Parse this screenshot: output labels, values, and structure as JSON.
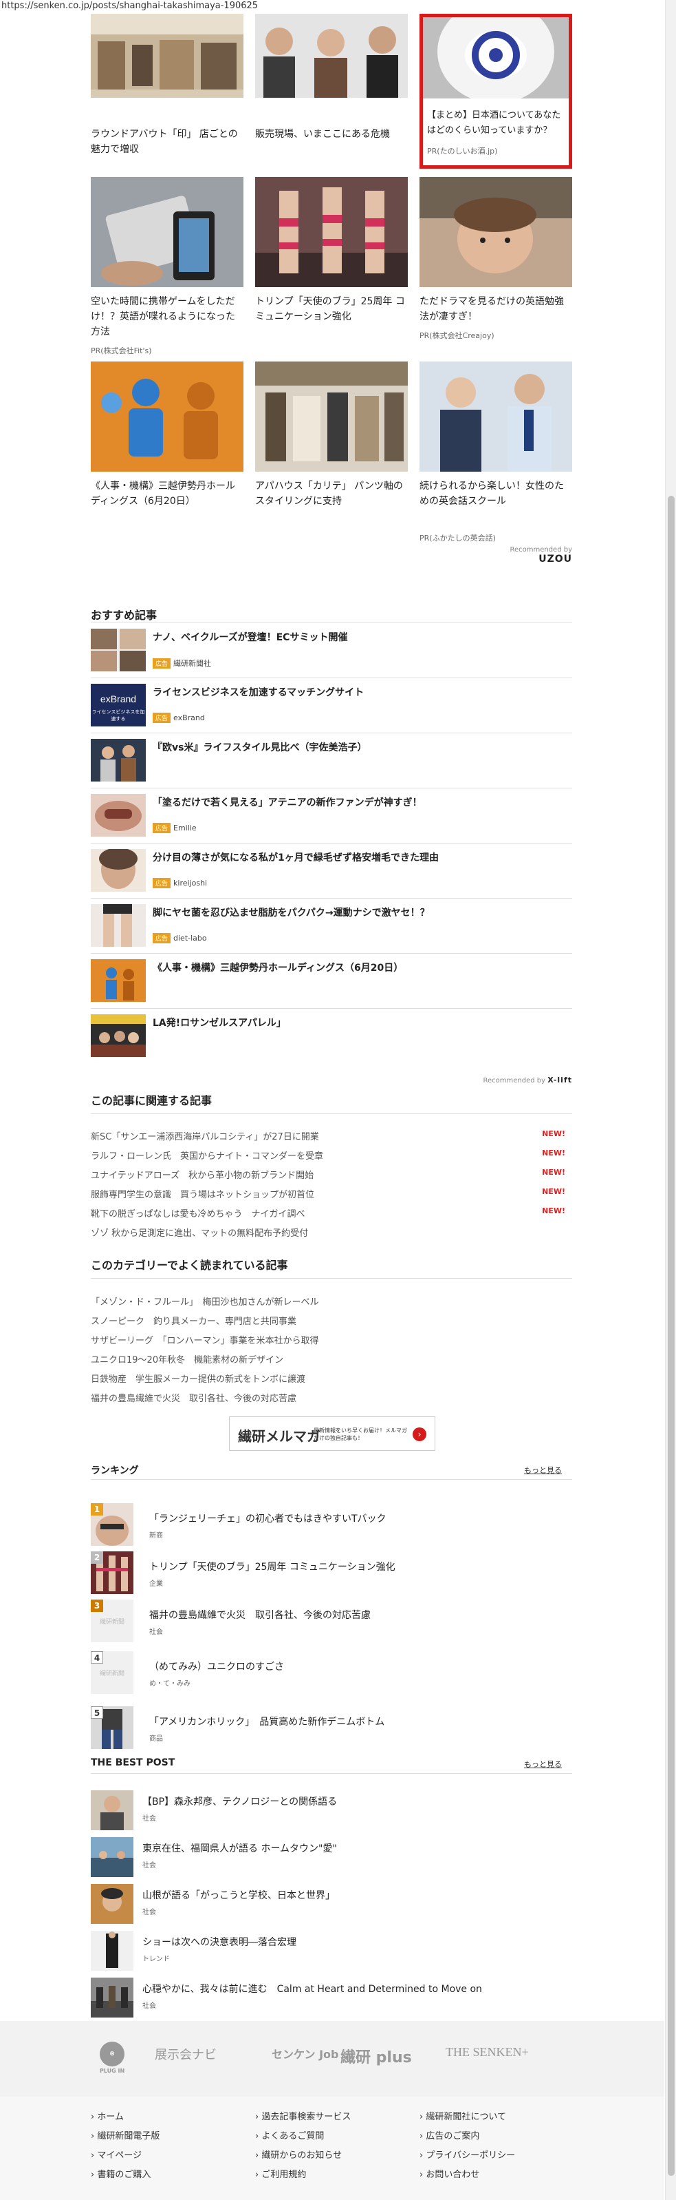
{
  "url": "https://senken.co.jp/posts/shanghai-takashimaya-190625",
  "ads": [
    {
      "title": "ラウンドアバウト「印」 店ごとの魅力で増収",
      "pr": ""
    },
    {
      "title": "販売現場、いまここにある危機",
      "pr": ""
    },
    {
      "title": "【まとめ】日本酒についてあなたはどのくらい知っていますか？",
      "pr": "PR(たのしいお酒.jp)"
    },
    {
      "title": "空いた時間に携帯ゲームをしただけ！？英語が喋れるようになった方法",
      "pr": "PR(株式会社Fit's)"
    },
    {
      "title": "トリンプ「天使のブラ」25周年 コミュニケーション強化",
      "pr": ""
    },
    {
      "title": "ただドラマを見るだけの英語勉強法が凄すぎ！",
      "pr": "PR(株式会社Creajoy)"
    },
    {
      "title": "《人事・機構》三越伊勢丹ホールディングス（6月20日）",
      "pr": ""
    },
    {
      "title": "アパハウス「カリテ」 パンツ軸のスタイリングに支持",
      "pr": ""
    },
    {
      "title": "続けられるから楽しい！女性のための英会話スクール",
      "pr": "PR(ふかたしの英会話)"
    }
  ],
  "recommended_by_1": {
    "label": "Recommended by",
    "brand": "UZOU"
  },
  "osusume": {
    "heading": "おすすめ記事",
    "items": [
      {
        "title": "ナノ、ベイクルーズが登壇！ECサミット開催",
        "tag": "広告",
        "source": "繊研新聞社"
      },
      {
        "title": "ライセンスビジネスを加速するマッチングサイト",
        "tag": "広告",
        "source": "exBrand"
      },
      {
        "title": "『欧vs米』ライフスタイル見比べ（宇佐美浩子）",
        "tag": "",
        "source": ""
      },
      {
        "title": "「塗るだけで若く見える」アテニアの新作ファンデが神すぎ！",
        "tag": "広告",
        "source": "Emilie"
      },
      {
        "title": "分け目の薄さが気になる私が1ヶ月で緑毛ぜず格安増毛できた理由",
        "tag": "広告",
        "source": "kireijoshi"
      },
      {
        "title": "脚にヤセ菌を忍び込ませ脂肪をパクパク→運動ナシで激ヤセ！？",
        "tag": "広告",
        "source": "diet-labo"
      },
      {
        "title": "《人事・機構》三越伊勢丹ホールディングス（6月20日）",
        "tag": "",
        "source": ""
      },
      {
        "title": "LA発!ロサンゼルスアパレル」",
        "tag": "",
        "source": ""
      }
    ],
    "recby": "Recommended by",
    "recby_brand": "X-lift",
    "exbrand_logo": "exBrand",
    "exbrand_sub": "ライセンスビジネスを加速する"
  },
  "related": {
    "heading": "この記事に関連する記事",
    "new_label": "NEW!",
    "items": [
      {
        "title": "新SC「サンエー浦添西海岸パルコシティ」が27日に開業",
        "new": true
      },
      {
        "title": "ラルフ・ローレン氏　英国からナイト・コマンダーを受章",
        "new": true
      },
      {
        "title": "ユナイテッドアローズ　秋から革小物の新ブランド開始",
        "new": true
      },
      {
        "title": "服飾専門学生の意識　買う場はネットショップが初首位",
        "new": true
      },
      {
        "title": "靴下の脱ぎっぱなしは愛も冷めちゃう　ナイガイ調べ",
        "new": true
      },
      {
        "title": "ゾゾ 秋から足測定に進出、マットの無料配布予約受付",
        "new": false
      }
    ]
  },
  "category": {
    "heading": "このカテゴリーでよく読まれている記事",
    "items": [
      "「メゾン・ド・フルール」　梅田沙也加さんが新レーベル",
      "スノーピーク　釣り具メーカー、専門店と共同事業",
      "サザビーリーグ　「ロンハーマン」事業を米本社から取得",
      "ユニクロ19～20年秋冬　機能素材の新デザイン",
      "日鉄物産　学生服メーカー提供の新式をトンボに譲渡",
      "福井の豊島繊維で火災　取引各社、今後の対応苦慮"
    ]
  },
  "mailmag": {
    "title": "繊研メルマガ",
    "sub": "最新情報をいち早くお届け！メルマガだけの独自記事も！",
    "btn": "›"
  },
  "ranking": {
    "heading": "ランキング",
    "more": "もっと見る",
    "items": [
      {
        "rank": "1",
        "title": "「ランジェリーチェ」の初心者でもはきやすいTバック",
        "cat": "新商"
      },
      {
        "rank": "2",
        "title": "トリンプ「天使のブラ」25周年 コミュニケーション強化",
        "cat": "企業"
      },
      {
        "rank": "3",
        "title": "福井の豊島繊維で火災　取引各社、今後の対応苦慮",
        "cat": "社会"
      },
      {
        "rank": "4",
        "title": "（めてみみ）ユニクロのすごさ",
        "cat": "め・て・みみ"
      },
      {
        "rank": "5",
        "title": "「アメリカンホリック」　品質高めた新作デニムボトム",
        "cat": "商品"
      }
    ],
    "placeholder": "繊研新聞"
  },
  "best": {
    "heading": "THE BEST POST",
    "more": "もっと見る",
    "items": [
      {
        "title": "【BP】森永邦彦、テクノロジーとの関係語る",
        "cat": "社会"
      },
      {
        "title": "東京在住、福岡県人が語る ホームタウン\"愛\"",
        "cat": "社会"
      },
      {
        "title": "山根が語る「がっこうと学校、日本と世界」",
        "cat": "社会"
      },
      {
        "title": "ショーは次への決意表明―落合宏理",
        "cat": "トレンド"
      },
      {
        "title": "心穏やかに、我々は前に進む　Calm at Heart and Determined to Move on",
        "cat": "社会"
      }
    ]
  },
  "footer_brands": [
    "PLUG IN",
    "展示会ナビ",
    "センケン Job",
    "繊研 plus",
    "THE SENKEN+"
  ],
  "footer_links": [
    [
      "ホーム",
      "繊研新聞電子版",
      "マイページ",
      "書籍のご購入"
    ],
    [
      "過去記事検索サービス",
      "よくあるご質問",
      "繊研からのお知らせ",
      "ご利用規約"
    ],
    [
      "繊研新聞社について",
      "広告のご案内",
      "プライバシーポリシー",
      "お問い合わせ"
    ]
  ],
  "colors": {
    "accent": "#d61b1b",
    "new": "#e21d1d",
    "rank1": "#e8a020",
    "rank3": "#cc7a00"
  }
}
